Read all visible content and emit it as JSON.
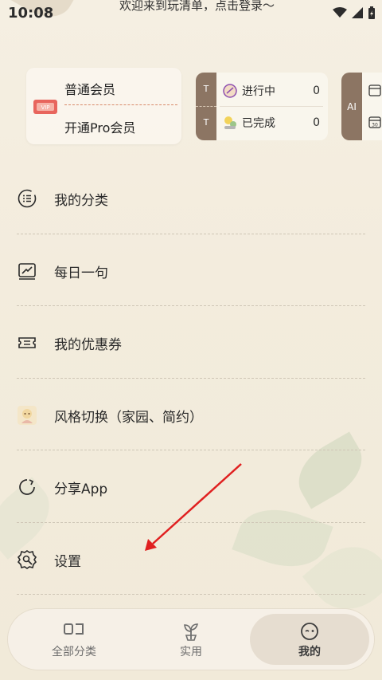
{
  "status": {
    "time": "10:08",
    "welcome": "欢迎来到玩清单，点击登录～"
  },
  "member": {
    "plain": "普通会员",
    "pro": "开通Pro会员"
  },
  "tasks": {
    "tab_letter": "T",
    "rows": [
      {
        "label": "进行中",
        "count": "0"
      },
      {
        "label": "已完成",
        "count": "0"
      }
    ],
    "ai_label": "AI"
  },
  "menu": [
    {
      "label": "我的分类",
      "icon": "category-list-icon"
    },
    {
      "label": "每日一句",
      "icon": "daily-quote-icon"
    },
    {
      "label": "我的优惠券",
      "icon": "coupon-icon"
    },
    {
      "label": "风格切换（家园、简约）",
      "icon": "style-switch-icon"
    },
    {
      "label": "分享App",
      "icon": "share-icon"
    },
    {
      "label": "设置",
      "icon": "settings-icon"
    }
  ],
  "nav": {
    "items": [
      {
        "label": "全部分类",
        "icon": "all-categories-icon"
      },
      {
        "label": "实用",
        "icon": "sprout-icon"
      },
      {
        "label": "我的",
        "icon": "mine-face-icon"
      }
    ],
    "active_index": 2
  },
  "colors": {
    "accent_brown": "#8c7563",
    "annotation_arrow": "#e02020",
    "vip_red": "#e8655d"
  }
}
